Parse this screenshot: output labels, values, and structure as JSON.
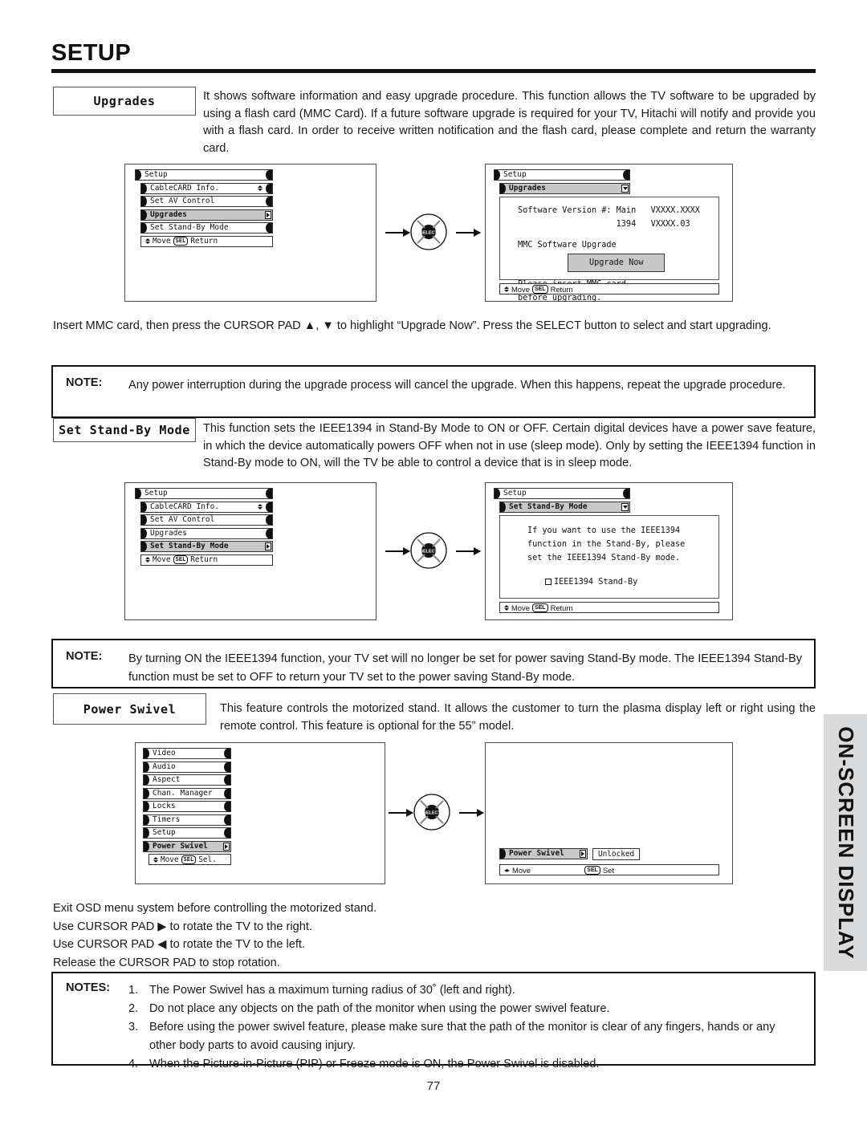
{
  "page": {
    "title": "SETUP",
    "number": "77",
    "side_tab": "ON-SCREEN DISPLAY"
  },
  "sections": {
    "upgrades": {
      "label": "Upgrades",
      "description": "It shows software information and easy upgrade procedure.  This function allows the TV software to be upgraded by using a flash card (MMC Card).  If a future software upgrade is required for your TV, Hitachi will notify and provide you with a flash card.  In order to receive written notification and the flash card, please complete and return the warranty card.",
      "instruction": "Insert MMC card, then press the CURSOR PAD ▲, ▼ to highlight “Upgrade Now”.  Press the SELECT button to select and start upgrading.",
      "note": {
        "keyword": "NOTE:",
        "text": "Any power interruption during the upgrade process will cancel the upgrade.  When this happens, repeat the upgrade procedure."
      }
    },
    "standby": {
      "label": "Set Stand-By Mode",
      "description": "This function sets the IEEE1394 in Stand-By Mode to ON or OFF.  Certain digital devices have a power save feature, in which the device automatically powers OFF when not in use (sleep mode).  Only by setting the IEEE1394 function in Stand-By mode to ON, will the TV be able to control a device that is in sleep mode.",
      "note": {
        "keyword": "NOTE:",
        "text": "By turning ON the IEEE1394 function, your TV set will no longer be set for power saving Stand-By mode.  The IEEE1394 Stand-By function must be set to OFF to return your TV set to the power saving Stand-By mode."
      }
    },
    "swivel": {
      "label": "Power Swivel",
      "description": "This feature controls the motorized stand.  It allows the customer to turn the plasma display left or right using the remote control.  This feature is optional for the 55” model.",
      "instructions": [
        "Exit OSD menu system before controlling the motorized stand.",
        "Use CURSOR PAD ▶ to rotate the TV to the right.",
        "Use CURSOR PAD ◀ to rotate the TV to the left.",
        "Release the CURSOR PAD to stop rotation."
      ],
      "notes": {
        "keyword": "NOTES:",
        "items": [
          {
            "num": "1.",
            "text": "The Power Swivel has a maximum turning radius of 30˚ (left and right)."
          },
          {
            "num": "2.",
            "text": "Do not place any objects on the path of the monitor when using the power swivel feature."
          },
          {
            "num": "3.",
            "text": "Before using the power swivel feature, please make sure that the path of the monitor is clear of any fingers, hands or any other body parts to avoid causing injury."
          },
          {
            "num": "4.",
            "text": "When the Picture-in-Picture (PIP) or Freeze mode is ON, the Power Swivel is disabled."
          }
        ]
      }
    }
  },
  "osd": {
    "setup_menu_upgrades": {
      "title": "Setup",
      "items": [
        {
          "label": "CableCARD Info.",
          "state": "scroll"
        },
        {
          "label": "Set AV Control",
          "state": "normal"
        },
        {
          "label": "Upgrades",
          "state": "selected"
        },
        {
          "label": "Set Stand-By Mode",
          "state": "normal"
        }
      ],
      "footer_move": "Move",
      "footer_key": "SEL",
      "footer_action": "Return"
    },
    "setup_menu_standby": {
      "title": "Setup",
      "items": [
        {
          "label": "CableCARD Info.",
          "state": "scroll"
        },
        {
          "label": "Set AV Control",
          "state": "normal"
        },
        {
          "label": "Upgrades",
          "state": "normal"
        },
        {
          "label": "Set Stand-By Mode",
          "state": "selected"
        }
      ],
      "footer_move": "Move",
      "footer_key": "SEL",
      "footer_action": "Return"
    },
    "upgrades_screen": {
      "title": "Setup",
      "subtitle": "Upgrades",
      "line_version_main": "Software Version #: Main   VXXXX.XXXX",
      "line_version_1394": "                    1394   VXXXX.03",
      "line_mmc": "MMC Software Upgrade",
      "button": "Upgrade Now",
      "line_insert_1": "Please insert MMC card",
      "line_insert_2": "before upgrading.",
      "footer_move": "Move",
      "footer_key": "SEL",
      "footer_action": "Return"
    },
    "standby_screen": {
      "title": "Setup",
      "subtitle": "Set Stand-By Mode",
      "line1": "If you want to use the IEEE1394",
      "line2": "function in the Stand-By, please",
      "line3": "set the IEEE1394 Stand-By mode.",
      "checkbox_label": "IEEE1394 Stand-By",
      "footer_move": "Move",
      "footer_key": "SEL",
      "footer_action": "Return"
    },
    "main_menu": {
      "items": [
        {
          "label": "Video",
          "state": "normal"
        },
        {
          "label": "Audio",
          "state": "normal"
        },
        {
          "label": "Aspect",
          "state": "normal"
        },
        {
          "label": "Chan. Manager",
          "state": "normal"
        },
        {
          "label": "Locks",
          "state": "normal"
        },
        {
          "label": "Timers",
          "state": "normal"
        },
        {
          "label": "Setup",
          "state": "normal"
        },
        {
          "label": "Power Swivel",
          "state": "selected"
        }
      ],
      "footer_move": "Move",
      "footer_key": "SEL",
      "footer_action": "Sel."
    },
    "swivel_screen": {
      "title": "Power Swivel",
      "status": "Unlocked",
      "footer_move": "Move",
      "footer_key": "SEL",
      "footer_action": "Set"
    },
    "select_pad_label": "SELECT"
  },
  "colors": {
    "ink": "#111111",
    "selected_row": "#c8c8c8",
    "side_tab": "#d8dadc"
  }
}
